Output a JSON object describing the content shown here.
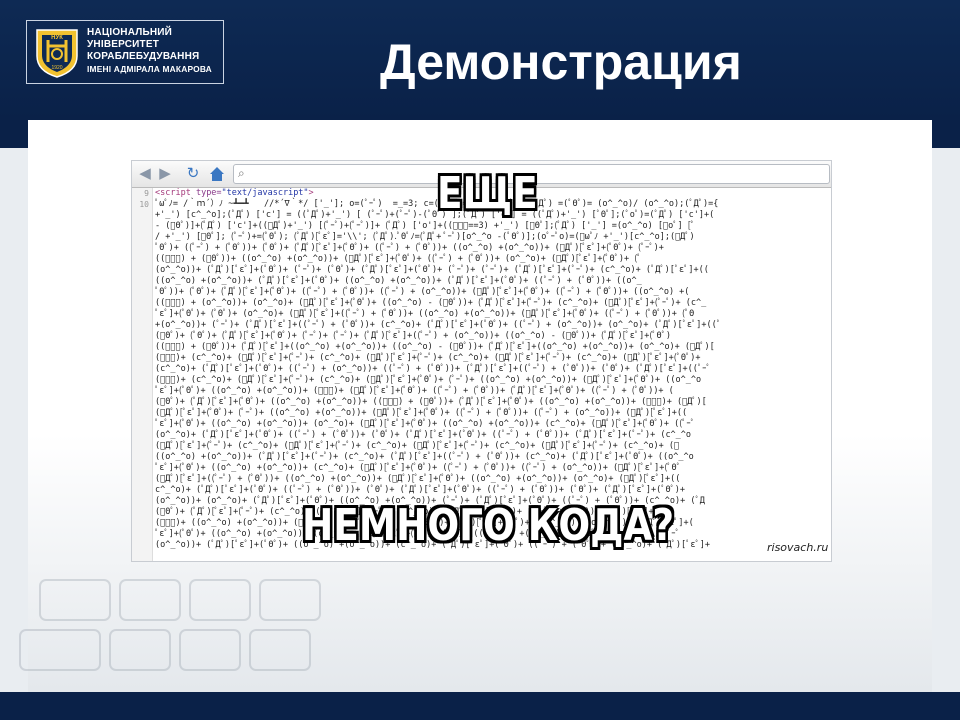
{
  "header": {
    "logo": {
      "lines": [
        "НАЦІОНАЛЬНИЙ",
        "УНІВЕРСИТЕТ",
        "КОРАБЛЕБУДУВАННЯ",
        "ІМЕНІ АДМІРАЛА МАКАРОВА"
      ],
      "emblem_text": "НУК",
      "emblem_year": "1920"
    },
    "title": "Демонстрация"
  },
  "meme": {
    "top_text": "ЕЩЕ",
    "bottom_text": "НЕМНОГО КОДА?",
    "watermark": "risovach.ru",
    "line_numbers": [
      "9",
      "10"
    ],
    "script_line": {
      "tag_open": "<script ",
      "attr": "type=",
      "value": "\"text/javascript\"",
      "tag_close": ">"
    },
    "code_lines": [
      "ﾟωﾟﾉ= /｀ｍ´）ﾉ ~┻━┻   //*´∇｀*/ ['_']; o=(ﾟｰﾟ)  =_=3; c=(ﾟΘﾟ) =(ﾟｰﾟ)-(ﾟｰﾟ); (ﾟДﾟ) =(ﾟΘﾟ)= (o^_^o)/ (o^_^o);(ﾟДﾟ)={",
      "+'_') [c^_^o];(ﾟДﾟ) ['c'] = ((ﾟДﾟ)+'_') [ (ﾟｰﾟ)+(ﾟｰﾟ)-(ﾟΘﾟ) ];(ﾟДﾟ) ['o'] = ((ﾟДﾟ)+'_') [ﾟΘﾟ];(ﾟoﾟ)=(ﾟДﾟ) ['c']+(",
      "- (ﾟΘﾟ)]+(ﾟДﾟ) ['c']+((ﾟДﾟ)+'_') [(ﾟｰﾟ)+(ﾟｰﾟ)]+ (ﾟДﾟ) ['o']+((ﾟｰﾟ==3) +'_') [ﾟΘﾟ];(ﾟДﾟ) ['_'] =(o^_^o) [ﾟoﾟ] [ﾟ",
      "/ +'_') [ﾟΘﾟ]; (ﾟｰﾟ)+=(ﾟΘﾟ); (ﾟДﾟ)[ﾟεﾟ]='\\\\'; (ﾟДﾟ).ﾟΘﾟﾉ=(ﾟДﾟ+ ﾟｰﾟ)[o^_^o -(ﾟΘﾟ)];(oﾟｰﾟo)=(ﾟωﾟﾉ +'_')[c^_^o];(ﾟДﾟ)",
      "ﾟΘﾟ)+ ((ﾟｰﾟ) + (ﾟΘﾟ))+ (ﾟΘﾟ)+ (ﾟДﾟ)[ﾟεﾟ]+(ﾟΘﾟ)+ ((ﾟｰﾟ) + (ﾟΘﾟ))+ ((o^_^o) +(o^_^o))+ (ﾟДﾟ)[ﾟεﾟ]+(ﾟΘﾟ)+ (ﾟｰﾟ)+",
      "((ﾟｰﾟ) + (ﾟΘﾟ))+ ((o^_^o) +(o^_^o))+ (ﾟДﾟ)[ﾟεﾟ]+(ﾟΘﾟ)+ ((ﾟｰﾟ) + (ﾟΘﾟ))+ (o^_^o)+ (ﾟДﾟ)[ﾟεﾟ]+(ﾟΘﾟ)+ (ﾟ",
      "(o^_^o))+ (ﾟДﾟ)[ﾟεﾟ]+(ﾟΘﾟ)+ (ﾟｰﾟ)+ (ﾟΘﾟ)+ (ﾟДﾟ)[ﾟεﾟ]+(ﾟΘﾟ)+ (ﾟｰﾟ)+ (ﾟｰﾟ)+ (ﾟДﾟ)[ﾟεﾟ]+(ﾟｰﾟ)+ (c^_^o)+ (ﾟДﾟ)[ﾟεﾟ]+((",
      "((o^_^o) +(o^_^o))+ (ﾟДﾟ)[ﾟεﾟ]+(ﾟΘﾟ)+ ((o^_^o) +(o^_^o))+ (ﾟДﾟ)[ﾟεﾟ]+(ﾟΘﾟ)+ ((ﾟｰﾟ) + (ﾟΘﾟ))+ ((o^_",
      "ﾟΘﾟ))+ (ﾟΘﾟ)+ (ﾟДﾟ)[ﾟεﾟ]+(ﾟΘﾟ)+ ((ﾟｰﾟ) + (ﾟΘﾟ))+ ((ﾟｰﾟ) + (o^_^o))+ (ﾟДﾟ)[ﾟεﾟ]+(ﾟΘﾟ)+ ((ﾟｰﾟ) + (ﾟΘﾟ))+ ((o^_^o) +(",
      "((ﾟｰﾟ) + (o^_^o))+ (o^_^o)+ (ﾟДﾟ)[ﾟεﾟ]+(ﾟΘﾟ)+ ((o^_^o) - (ﾟΘﾟ))+ (ﾟДﾟ)[ﾟεﾟ]+(ﾟｰﾟ)+ (c^_^o)+ (ﾟДﾟ)[ﾟεﾟ]+(ﾟｰﾟ)+ (c^_",
      "ﾟεﾟ]+(ﾟΘﾟ)+ (ﾟΘﾟ)+ (o^_^o)+ (ﾟДﾟ)[ﾟεﾟ]+((ﾟｰﾟ) + (ﾟΘﾟ))+ ((o^_^o) +(o^_^o))+ (ﾟДﾟ)[ﾟεﾟ]+(ﾟΘﾟ)+ ((ﾟｰﾟ) + (ﾟΘﾟ))+ (ﾟΘ",
      "+(o^_^o))+ (ﾟｰﾟ)+ (ﾟДﾟ)[ﾟεﾟ]+((ﾟｰﾟ) + (ﾟΘﾟ))+ (c^_^o)+ (ﾟДﾟ)[ﾟεﾟ]+(ﾟΘﾟ)+ ((ﾟｰﾟ) + (o^_^o))+ (o^_^o)+ (ﾟДﾟ)[ﾟεﾟ]+((ﾟ",
      "(ﾟΘﾟ)+ (ﾟΘﾟ)+ (ﾟДﾟ)[ﾟεﾟ]+(ﾟΘﾟ)+ (ﾟｰﾟ)+ (ﾟｰﾟ)+ (ﾟДﾟ)[ﾟεﾟ]+((ﾟｰﾟ) + (o^_^o))+ ((o^_^o) - (ﾟΘﾟ))+ (ﾟДﾟ)[ﾟεﾟ]+(ﾟΘﾟ)",
      "((ﾟｰﾟ) + (ﾟΘﾟ))+ (ﾟДﾟ)[ﾟεﾟ]+((o^_^o) +(o^_^o))+ ((o^_^o) - (ﾟΘﾟ))+ (ﾟДﾟ)[ﾟεﾟ]+((o^_^o) +(o^_^o))+ (o^_^o)+ (ﾟДﾟ)[",
      "(ﾟｰﾟ)+ (c^_^o)+ (ﾟДﾟ)[ﾟεﾟ]+(ﾟｰﾟ)+ (c^_^o)+ (ﾟДﾟ)[ﾟεﾟ]+(ﾟｰﾟ)+ (c^_^o)+ (ﾟДﾟ)[ﾟεﾟ]+(ﾟｰﾟ)+ (c^_^o)+ (ﾟДﾟ)[ﾟεﾟ]+(ﾟΘﾟ)+",
      "(c^_^o)+ (ﾟДﾟ)[ﾟεﾟ]+(ﾟΘﾟ)+ ((ﾟｰﾟ) + (o^_^o))+ ((ﾟｰﾟ) + (ﾟΘﾟ))+ (ﾟДﾟ)[ﾟεﾟ]+((ﾟｰﾟ) + (ﾟΘﾟ))+ (ﾟΘﾟ)+ (ﾟДﾟ)[ﾟεﾟ]+((ﾟｰﾟ",
      "(ﾟｰﾟ)+ (c^_^o)+ (ﾟДﾟ)[ﾟεﾟ]+(ﾟｰﾟ)+ (c^_^o)+ (ﾟДﾟ)[ﾟεﾟ]+(ﾟΘﾟ)+ (ﾟｰﾟ)+ ((o^_^o) +(o^_^o))+ (ﾟДﾟ)[ﾟεﾟ]+(ﾟΘﾟ)+ ((o^_^o",
      "ﾟεﾟ]+(ﾟΘﾟ)+ ((o^_^o) +(o^_^o))+ (ﾟｰﾟ)+ (ﾟДﾟ)[ﾟεﾟ]+(ﾟΘﾟ)+ ((ﾟｰﾟ) + (ﾟΘﾟ))+ (ﾟДﾟ)[ﾟεﾟ]+(ﾟΘﾟ)+ ((ﾟｰﾟ) + (ﾟΘﾟ))+ (",
      "(ﾟΘﾟ)+ (ﾟДﾟ)[ﾟεﾟ]+(ﾟΘﾟ)+ ((o^_^o) +(o^_^o))+ ((ﾟｰﾟ) + (ﾟΘﾟ))+ (ﾟДﾟ)[ﾟεﾟ]+(ﾟΘﾟ)+ ((o^_^o) +(o^_^o))+ (ﾟｰﾟ)+ (ﾟДﾟ)[",
      "(ﾟДﾟ)[ﾟεﾟ]+(ﾟΘﾟ)+ (ﾟｰﾟ)+ ((o^_^o) +(o^_^o))+ (ﾟДﾟ)[ﾟεﾟ]+(ﾟΘﾟ)+ ((ﾟｰﾟ) + (ﾟΘﾟ))+ ((ﾟｰﾟ) + (o^_^o))+ (ﾟДﾟ)[ﾟεﾟ]+((",
      "ﾟεﾟ]+(ﾟΘﾟ)+ ((o^_^o) +(o^_^o))+ (o^_^o)+ (ﾟДﾟ)[ﾟεﾟ]+(ﾟΘﾟ)+ ((o^_^o) +(o^_^o))+ (c^_^o)+ (ﾟДﾟ)[ﾟεﾟ]+(ﾟΘﾟ)+ ((ﾟｰﾟ",
      "(o^_^o)+ (ﾟДﾟ)[ﾟεﾟ]+(ﾟΘﾟ)+ ((ﾟｰﾟ) + (ﾟΘﾟ))+ (ﾟΘﾟ)+ (ﾟДﾟ)[ﾟεﾟ]+(ﾟΘﾟ)+ ((ﾟｰﾟ) + (ﾟΘﾟ))+ (ﾟДﾟ)[ﾟεﾟ]+(ﾟｰﾟ)+ (c^_^o",
      "(ﾟДﾟ)[ﾟεﾟ]+(ﾟｰﾟ)+ (c^_^o)+ (ﾟДﾟ)[ﾟεﾟ]+(ﾟｰﾟ)+ (c^_^o)+ (ﾟДﾟ)[ﾟεﾟ]+(ﾟｰﾟ)+ (c^_^o)+ (ﾟДﾟ)[ﾟεﾟ]+(ﾟｰﾟ)+ (c^_^o)+ (ﾟ",
      "((o^_^o) +(o^_^o))+ (ﾟДﾟ)[ﾟεﾟ]+(ﾟｰﾟ)+ (c^_^o)+ (ﾟДﾟ)[ﾟεﾟ]+((ﾟｰﾟ) + (ﾟΘﾟ))+ (c^_^o)+ (ﾟДﾟ)[ﾟεﾟ]+(ﾟΘﾟ)+ ((o^_^o",
      "ﾟεﾟ]+(ﾟΘﾟ)+ ((o^_^o) +(o^_^o))+ (c^_^o)+ (ﾟДﾟ)[ﾟεﾟ]+(ﾟΘﾟ)+ ((ﾟｰﾟ) + (ﾟΘﾟ))+ ((ﾟｰﾟ) + (o^_^o))+ (ﾟДﾟ)[ﾟεﾟ]+(ﾟΘﾟ",
      "(ﾟДﾟ)[ﾟεﾟ]+((ﾟｰﾟ) + (ﾟΘﾟ))+ ((o^_^o) +(o^_^o))+ (ﾟДﾟ)[ﾟεﾟ]+(ﾟΘﾟ)+ ((o^_^o) +(o^_^o))+ (o^_^o)+ (ﾟДﾟ)[ﾟεﾟ]+((",
      "c^_^o)+ (ﾟДﾟ)[ﾟεﾟ]+(ﾟΘﾟ)+ ((ﾟｰﾟ) + (ﾟΘﾟ))+ (ﾟΘﾟ)+ (ﾟДﾟ)[ﾟεﾟ]+(ﾟΘﾟ)+ ((ﾟｰﾟ) + (ﾟΘﾟ))+ (ﾟΘﾟ)+ (ﾟДﾟ)[ﾟεﾟ]+(ﾟΘﾟ)+",
      "(o^_^o))+ (o^_^o)+ (ﾟДﾟ)[ﾟεﾟ]+(ﾟΘﾟ)+ ((o^_^o) +(o^_^o))+ (ﾟｰﾟ)+ (ﾟДﾟ)[ﾟεﾟ]+(ﾟΘﾟ)+ ((ﾟｰﾟ) + (ﾟΘﾟ))+ (c^_^o)+ (ﾟД",
      "(ﾟΘﾟ)+ (ﾟДﾟ)[ﾟεﾟ]+(ﾟｰﾟ)+ (c^_^o)+ (ﾟДﾟ)[ﾟεﾟ]+(ﾟｰﾟ)+ (c^_^o)+ (ﾟДﾟ)[ﾟεﾟ]+(ﾟΘﾟ)+ ((ﾟｰﾟ) + (ﾟΘﾟ))+ (ﾟДﾟ)[ﾟεﾟ]+(ﾟΘﾟ",
      "(ﾟｰﾟ)+ ((o^_^o) +(o^_^o))+ (ﾟДﾟ)[ﾟεﾟ]+(ﾟΘﾟ)+ ((ﾟｰﾟ) + (ﾟΘﾟ))+ (ﾟДﾟ)[ﾟεﾟ]+(ﾟΘﾟ)+ ((o^_^o) +(o^_^o))+ (ﾟДﾟ)[ﾟεﾟ]+(",
      "ﾟεﾟ]+(ﾟΘﾟ)+ ((o^_^o) +(o^_^o))+ (c^_^o)+ (ﾟДﾟ)[ﾟεﾟ]+(ﾟΘﾟ)+ (ﾟｰﾟ)+ ((o^_^o) +(o^_^o))+ (ﾟДﾟ)[ﾟεﾟ]+(ﾟΘﾟ)+ ((ﾟｰﾟ",
      "(o^_^o))+ (ﾟДﾟ)[ﾟεﾟ]+(ﾟΘﾟ)+ ((o^_^o) +(o^_^o))+ (c^_^o)+ (ﾟДﾟ)[ﾟεﾟ]+(ﾟΘﾟ)+ ((ﾟｰﾟ) + (ﾟΘﾟ))+ (c^_^o)+ (ﾟДﾟ)[ﾟεﾟ]+"
    ]
  }
}
